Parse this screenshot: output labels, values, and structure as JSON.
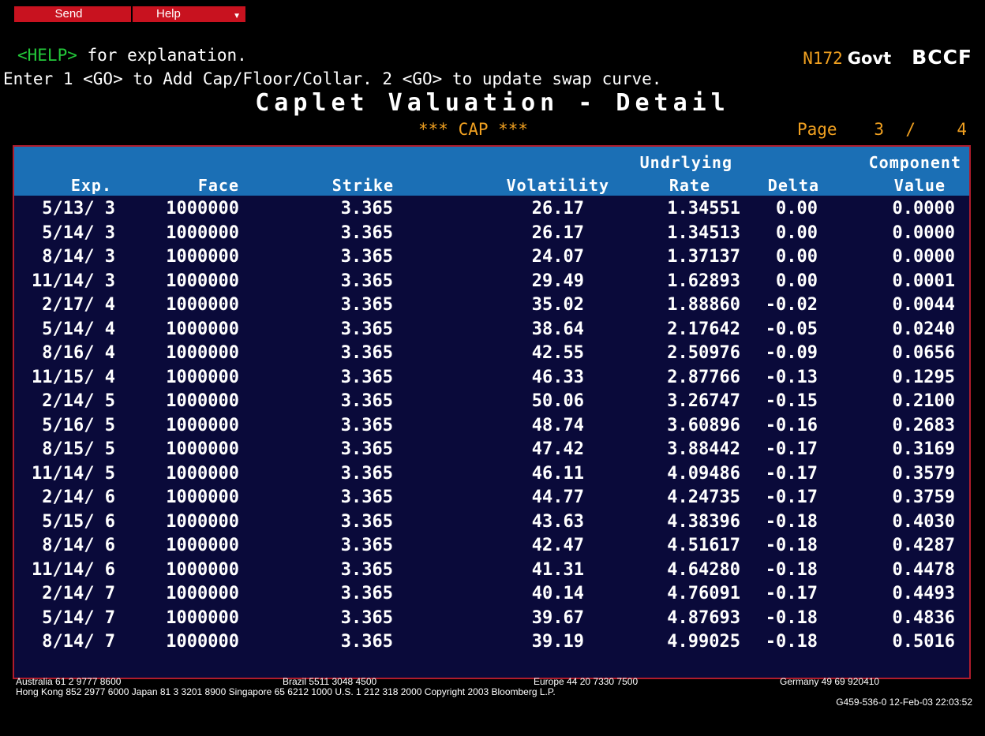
{
  "menu": {
    "send": "Send",
    "help": "Help"
  },
  "help_line": {
    "key": "<HELP>",
    "text": " for explanation."
  },
  "instruction": "Enter 1 <GO> to Add Cap/Floor/Collar. 2 <GO> to update swap curve.",
  "ticker": {
    "num": "N172",
    "sector": "Govt",
    "code": "BCCF"
  },
  "title": "Caplet Valuation - Detail",
  "subtitle": "*** CAP ***",
  "page": {
    "label": "Page",
    "current": "3",
    "sep": "/",
    "total": "4"
  },
  "table": {
    "headers": {
      "exp": "Exp.",
      "face": "Face",
      "strike": "Strike",
      "vol": "Volatility",
      "rate_top": "Undrlying",
      "rate_bot": "Rate",
      "delta": "Delta",
      "comp_top": "Component",
      "comp_bot": "Value"
    },
    "rows": [
      [
        "5/13/ 3",
        "1000000",
        "3.365",
        "26.17",
        "1.34551",
        "0.00",
        "0.0000"
      ],
      [
        "5/14/ 3",
        "1000000",
        "3.365",
        "26.17",
        "1.34513",
        "0.00",
        "0.0000"
      ],
      [
        "8/14/ 3",
        "1000000",
        "3.365",
        "24.07",
        "1.37137",
        "0.00",
        "0.0000"
      ],
      [
        "11/14/ 3",
        "1000000",
        "3.365",
        "29.49",
        "1.62893",
        "0.00",
        "0.0001"
      ],
      [
        "2/17/ 4",
        "1000000",
        "3.365",
        "35.02",
        "1.88860",
        "-0.02",
        "0.0044"
      ],
      [
        "5/14/ 4",
        "1000000",
        "3.365",
        "38.64",
        "2.17642",
        "-0.05",
        "0.0240"
      ],
      [
        "8/16/ 4",
        "1000000",
        "3.365",
        "42.55",
        "2.50976",
        "-0.09",
        "0.0656"
      ],
      [
        "11/15/ 4",
        "1000000",
        "3.365",
        "46.33",
        "2.87766",
        "-0.13",
        "0.1295"
      ],
      [
        "2/14/ 5",
        "1000000",
        "3.365",
        "50.06",
        "3.26747",
        "-0.15",
        "0.2100"
      ],
      [
        "5/16/ 5",
        "1000000",
        "3.365",
        "48.74",
        "3.60896",
        "-0.16",
        "0.2683"
      ],
      [
        "8/15/ 5",
        "1000000",
        "3.365",
        "47.42",
        "3.88442",
        "-0.17",
        "0.3169"
      ],
      [
        "11/14/ 5",
        "1000000",
        "3.365",
        "46.11",
        "4.09486",
        "-0.17",
        "0.3579"
      ],
      [
        "2/14/ 6",
        "1000000",
        "3.365",
        "44.77",
        "4.24735",
        "-0.17",
        "0.3759"
      ],
      [
        "5/15/ 6",
        "1000000",
        "3.365",
        "43.63",
        "4.38396",
        "-0.18",
        "0.4030"
      ],
      [
        "8/14/ 6",
        "1000000",
        "3.365",
        "42.47",
        "4.51617",
        "-0.18",
        "0.4287"
      ],
      [
        "11/14/ 6",
        "1000000",
        "3.365",
        "41.31",
        "4.64280",
        "-0.18",
        "0.4478"
      ],
      [
        "2/14/ 7",
        "1000000",
        "3.365",
        "40.14",
        "4.76091",
        "-0.17",
        "0.4493"
      ],
      [
        "5/14/ 7",
        "1000000",
        "3.365",
        "39.67",
        "4.87693",
        "-0.18",
        "0.4836"
      ],
      [
        "8/14/ 7",
        "1000000",
        "3.365",
        "39.19",
        "4.99025",
        "-0.18",
        "0.5016"
      ]
    ]
  },
  "footer": {
    "australia": "Australia 61 2 9777 8600",
    "brazil": "Brazil 5511 3048 4500",
    "europe": "Europe 44 20 7330 7500",
    "germany": "Germany 49 69 920410",
    "line2": "Hong Kong 852 2977 6000 Japan 81 3 3201 8900 Singapore 65 6212 1000 U.S. 1 212 318 2000 Copyright 2003 Bloomberg L.P.",
    "line3": "G459-536-0 12-Feb-03 22:03:52"
  },
  "colors": {
    "header_blue": "#1b6fb5",
    "menu_red": "#c8121f",
    "green": "#23c93a",
    "amber": "#f0a020"
  }
}
